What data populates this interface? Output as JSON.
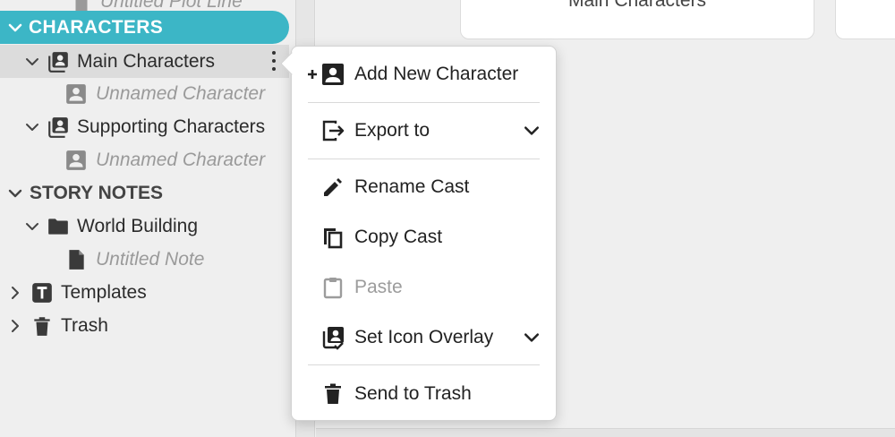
{
  "sidebar": {
    "clipped_item": "Untitled Plot Line",
    "characters_header": "CHARACTERS",
    "main_characters": "Main Characters",
    "unnamed_1": "Unnamed Character",
    "supporting_characters": "Supporting Characters",
    "unnamed_2": "Unnamed Character",
    "story_notes_header": "STORY NOTES",
    "world_building": "World Building",
    "untitled_note": "Untitled Note",
    "templates": "Templates",
    "trash": "Trash",
    "accent_color": "#3cb6c6"
  },
  "main": {
    "card_title": "Main Characters"
  },
  "context_menu": {
    "items": [
      {
        "label": "Add New Character",
        "icon": "add-person-icon"
      },
      {
        "label": "Export to",
        "icon": "export-icon",
        "has_submenu": true
      },
      {
        "label": "Rename Cast",
        "icon": "pencil-icon"
      },
      {
        "label": "Copy Cast",
        "icon": "copy-icon"
      },
      {
        "label": "Paste",
        "icon": "clipboard-icon",
        "disabled": true
      },
      {
        "label": "Set Icon Overlay",
        "icon": "contacts-check-icon",
        "has_submenu": true
      },
      {
        "label": "Send to Trash",
        "icon": "trash-icon"
      }
    ]
  }
}
